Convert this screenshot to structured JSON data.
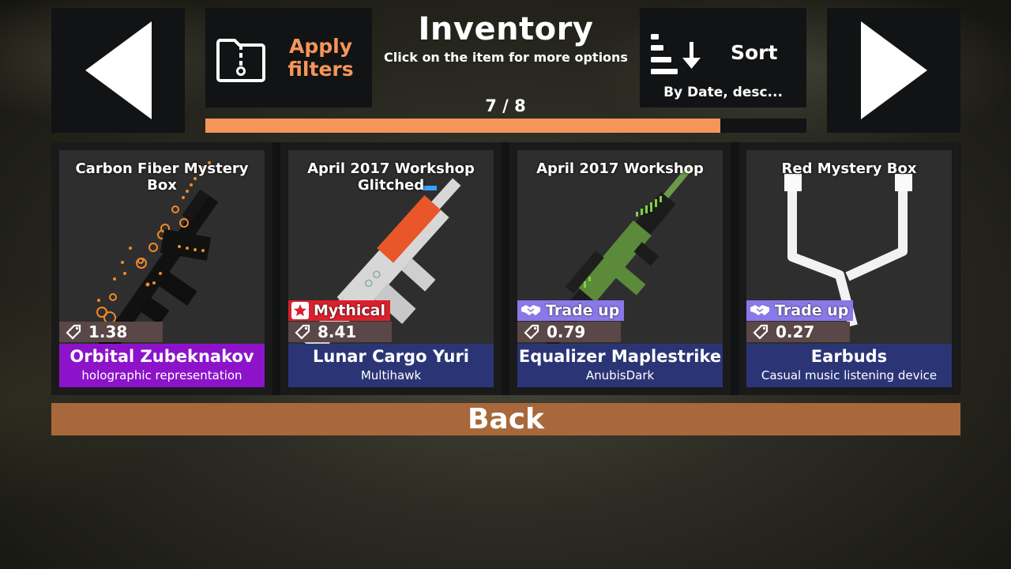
{
  "header": {
    "title": "Inventory",
    "subtitle": "Click on the item for more options",
    "page": "7 / 8",
    "progress_fraction": 0.857
  },
  "nav": {
    "prev_icon": "arrow-left-icon",
    "next_icon": "arrow-right-icon"
  },
  "filters": {
    "label": "Apply filters",
    "icon": "zip-folder-icon"
  },
  "sort": {
    "label": "Sort",
    "mode": "By Date, desc...",
    "icon": "sort-descending-icon"
  },
  "items": [
    {
      "case_name": "Carbon Fiber Mystery Box",
      "price": "1.38",
      "name": "Orbital Zubeknakov",
      "subtitle": "holographic representation",
      "tag": "",
      "nameplate_color": "#8c13c9"
    },
    {
      "case_name": "April 2017 Workshop Glitched",
      "price": "8.41",
      "name": "Lunar Cargo Yuri",
      "subtitle": "Multihawk",
      "tag": "Mythical",
      "nameplate_color": "#2b3576"
    },
    {
      "case_name": "April 2017 Workshop",
      "price": "0.79",
      "name": "Equalizer Maplestrike",
      "subtitle": "AnubisDark",
      "tag": "Trade up",
      "nameplate_color": "#2b3576"
    },
    {
      "case_name": "Red Mystery Box",
      "price": "0.27",
      "name": "Earbuds",
      "subtitle": "Casual music listening device",
      "tag": "Trade up",
      "nameplate_color": "#2b3576"
    }
  ],
  "back": {
    "label": "Back"
  },
  "colors": {
    "accent": "#f4955a",
    "mythical": "#d9202c",
    "tradeup": "#8878e8",
    "back": "#a8683b"
  }
}
